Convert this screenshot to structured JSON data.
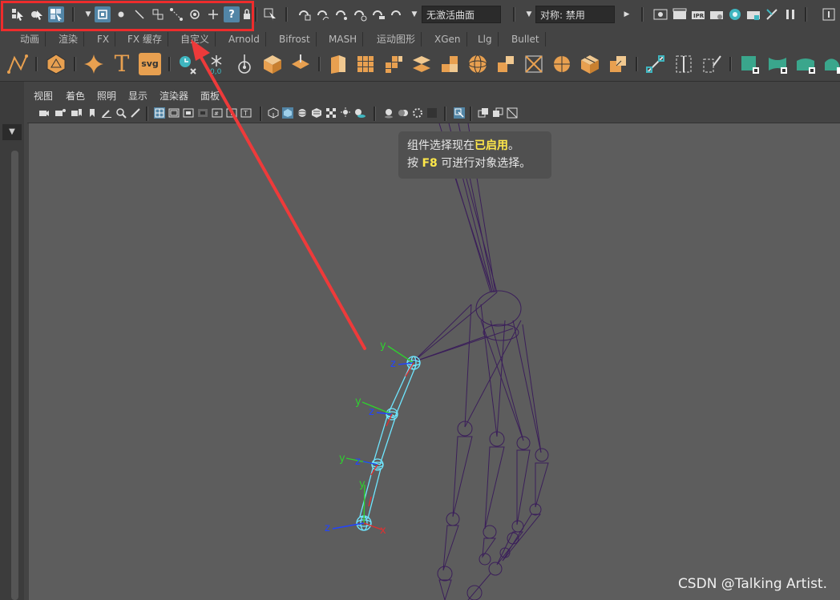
{
  "status_line": {
    "selection_mask_icons": [
      "select-by-hierarchy-icon",
      "select-by-object-type-icon",
      "select-by-component-type-icon"
    ],
    "component_icons": [
      "vertex-mask-icon",
      "point-mask-icon",
      "edge-mask-icon",
      "face-mask-icon",
      "uv-mask-icon",
      "pivot-mask-icon",
      "handle-mask-icon",
      "question-mask-icon",
      "lock-icon"
    ],
    "live_surface_value": "无激活曲面",
    "symmetry_value": "对称: 禁用"
  },
  "shelf_tabs": [
    "动画",
    "渲染",
    "FX",
    "FX 缓存",
    "自定义",
    "Arnold",
    "Bifrost",
    "MASH",
    "运动图形",
    "XGen",
    "Llg",
    "Bullet"
  ],
  "shelf": {
    "svg_label": "svg",
    "text_label": "T"
  },
  "panel_menu": [
    "视图",
    "着色",
    "照明",
    "显示",
    "渲染器",
    "面板"
  ],
  "viewport": {
    "tooltip": {
      "line1_before": "组件选择现在",
      "line1_highlight": "已启用",
      "line1_after": "。",
      "line2_before": "按 ",
      "line2_highlight": "F8",
      "line2_after": " 可进行对象选择。"
    },
    "axis_labels": {
      "y": "y",
      "z": "z",
      "x": "x"
    },
    "watermark": "CSDN @Talking Artist."
  },
  "colors": {
    "highlight_box": "#ee2c2c",
    "arrow": "#ee3a3a",
    "joint_selected": "#6fe6ff",
    "skeleton": "#3b1f5a",
    "tooltip_highlight": "#ffe84a",
    "selected_button": "#5285a6"
  }
}
